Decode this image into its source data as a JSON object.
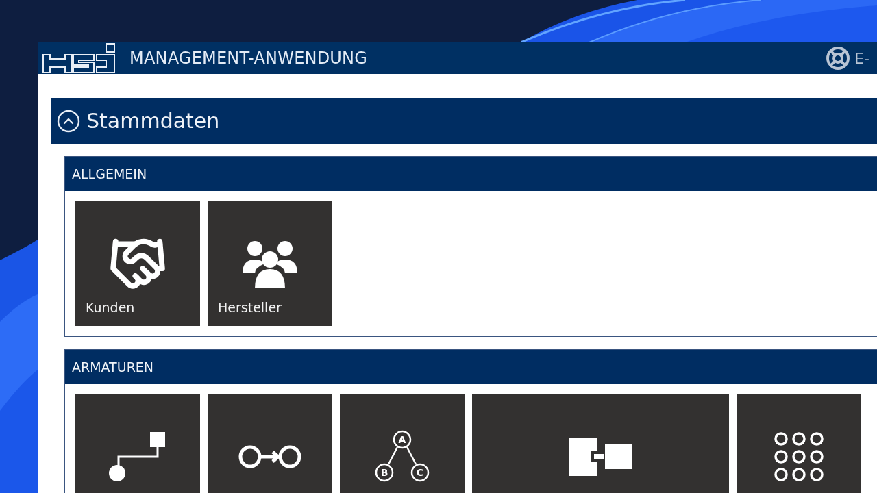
{
  "window": {
    "title": "MANAGEMENT-ANWENDUNG",
    "help_label": "E-"
  },
  "panel": {
    "title": "Stammdaten",
    "expanded": true,
    "sections": [
      {
        "title": "ALLGEMEIN",
        "tiles": [
          {
            "kind": "handshake",
            "label": "Kunden",
            "wide": false
          },
          {
            "kind": "people",
            "label": "Hersteller",
            "wide": false
          }
        ]
      },
      {
        "title": "ARMATUREN",
        "tiles": [
          {
            "kind": "route",
            "wide": false
          },
          {
            "kind": "flow",
            "wide": false
          },
          {
            "kind": "tree",
            "node_labels": [
              "A",
              "B",
              "C"
            ],
            "wide": false
          },
          {
            "kind": "blocks",
            "wide": true
          },
          {
            "kind": "grid",
            "wide": false
          }
        ]
      }
    ]
  }
}
